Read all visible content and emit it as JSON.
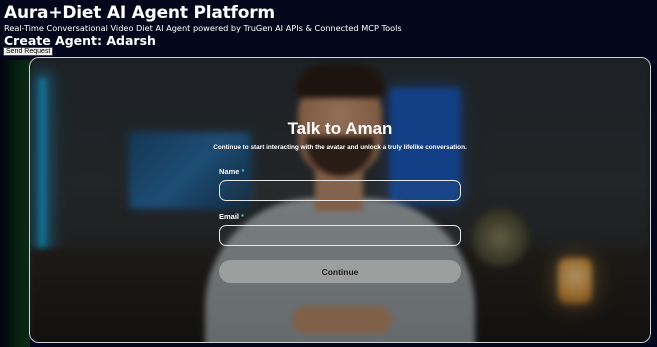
{
  "header": {
    "title": "Aura+Diet AI Agent Platform",
    "subtitle": "Real-Time Conversational Video Diet AI Agent powered by TruGen AI APIs & Connected MCP Tools",
    "agent_heading": "Create Agent: Adarsh",
    "send_request_label": "Send Request"
  },
  "form": {
    "title": "Talk to Aman",
    "description": "Continue to start interacting with the avatar and unlock a truly lifelike conversation.",
    "name_label": "Name",
    "email_label": "Email",
    "required_marker": "*",
    "name_value": "",
    "email_value": "",
    "continue_label": "Continue"
  },
  "colors": {
    "page_background": "#04071c",
    "required_marker": "#2fd4c0",
    "continue_button": "#aaaaaa"
  }
}
